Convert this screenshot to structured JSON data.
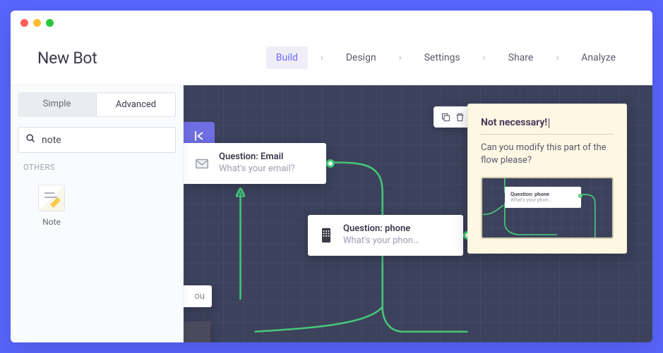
{
  "title": "New Bot",
  "nav": {
    "items": [
      "Build",
      "Design",
      "Settings",
      "Share",
      "Analyze"
    ],
    "active_index": 0
  },
  "sidebar": {
    "tabs": {
      "simple": "Simple",
      "advanced": "Advanced",
      "active": "advanced"
    },
    "search": {
      "value": "note"
    },
    "sections": {
      "others": {
        "header": "OTHERS",
        "items": [
          {
            "label": "Note",
            "icon": "note-icon"
          }
        ]
      }
    }
  },
  "canvas": {
    "nodes": {
      "email": {
        "title": "Question: Email",
        "subtitle": "What's your email?"
      },
      "phone": {
        "title": "Question: phone",
        "subtitle": "What's your phon…"
      },
      "fragment": {
        "text": "ou"
      }
    },
    "selection_actions": [
      "copy",
      "delete"
    ]
  },
  "note": {
    "title": "Not necessary!",
    "body": "Can you modify this part of the flow please?",
    "preview": {
      "title": "Question: phone",
      "subtitle": "What's your phon…"
    }
  }
}
